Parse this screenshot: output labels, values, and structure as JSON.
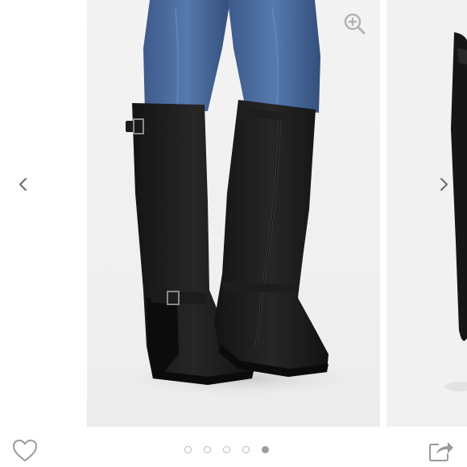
{
  "carousel": {
    "slide_count": 5,
    "active_index": 4,
    "main_image": {
      "icon": "knee-high-wedge-boots-photo"
    },
    "next_image": {
      "icon": "partial-boot-photo"
    },
    "prev_icon": "chevron-left-icon",
    "next_icon": "chevron-right-icon",
    "zoom_icon": "zoom-in-icon"
  },
  "actions": {
    "like_icon": "heart-outline-icon",
    "share_icon": "share-icon"
  },
  "colors": {
    "icon_gray": "#9a9a9a",
    "dot_inactive": "#b9b9b9",
    "dot_active": "#9e9e9e",
    "background": "#ffffff",
    "photo_bg": "#f0f0f0"
  }
}
